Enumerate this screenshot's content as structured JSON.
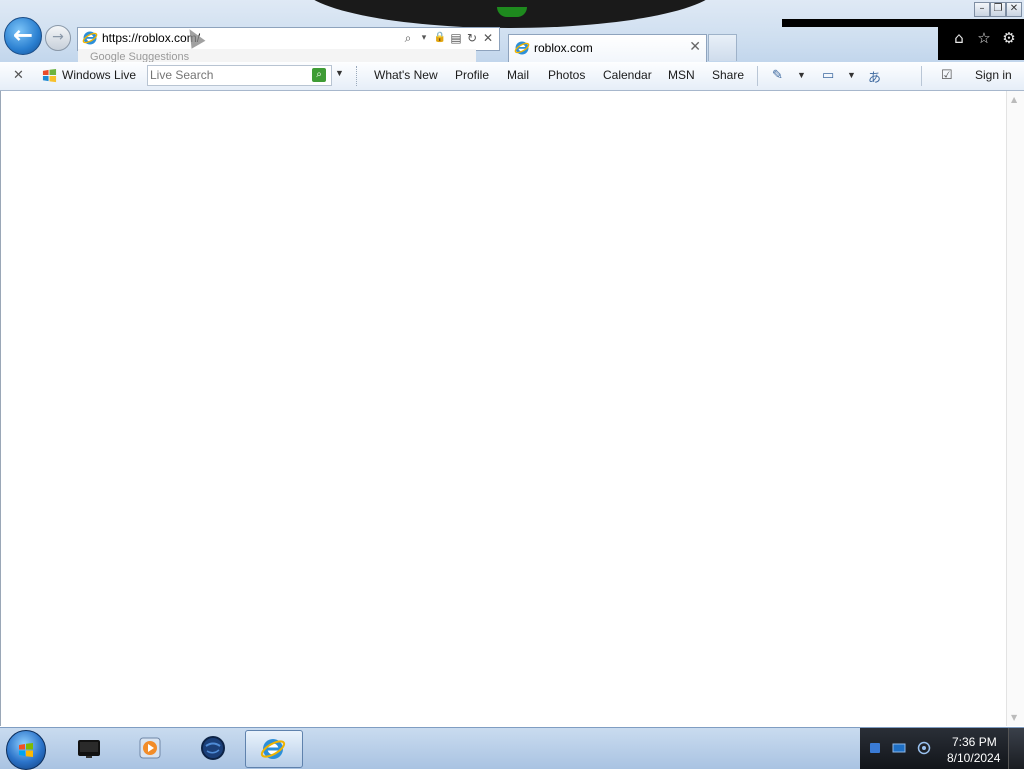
{
  "browser": {
    "address_url": "https://roblox.com/",
    "suggestion_label": "Google Suggestions",
    "tab_title": "roblox.com",
    "tab_close_glyph": "✕",
    "window_controls": {
      "minimize": "–",
      "restore": "❐",
      "close": "✕"
    },
    "back_glyph": "←",
    "forward_glyph": "→",
    "address_tools": {
      "search": "⌕",
      "dropdown": "▾",
      "lock": "🔒",
      "compat": "▤",
      "refresh": "↻",
      "stop": "✕"
    },
    "command_icons": [
      "home-icon",
      "favorites-star-icon",
      "tools-gear-icon"
    ],
    "command_glyphs": {
      "home": "⌂",
      "favorites": "☆",
      "tools": "⚙"
    }
  },
  "windows_live_toolbar": {
    "close_glyph": "✕",
    "brand_label": "Windows Live",
    "search_placeholder": "Live Search",
    "search_go_glyph": "⌕",
    "search_dropdown_glyph": "▼",
    "nav_items": [
      "What's New",
      "Profile",
      "Mail",
      "Photos",
      "Calendar",
      "MSN",
      "Share"
    ],
    "sign_in_label": "Sign in",
    "glyphs": {
      "blog": "✎",
      "caret": "▼",
      "window": "▭",
      "translate": "あ",
      "check": "☑"
    }
  },
  "taskbar": {
    "clock_time": "7:36 PM",
    "clock_date": "8/10/2024",
    "pinned": [
      "media-center-icon",
      "media-player-icon",
      "globe-icon",
      "internet-explorer-icon"
    ],
    "active_app": "internet-explorer-icon"
  },
  "colors": {
    "accent_blue": "#2a7fd0",
    "search_go_green": "#3f9c35",
    "taskbar_top": "#c9dbef",
    "tray_dark": "#12151a"
  }
}
